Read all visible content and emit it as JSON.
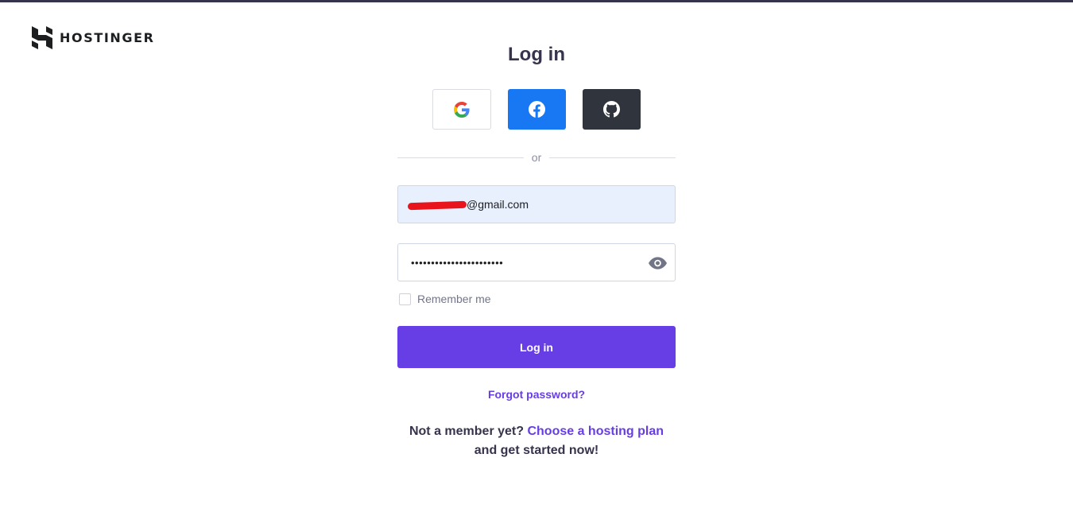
{
  "brand": {
    "name": "HOSTINGER",
    "logo_icon": "hostinger-h-logo-icon"
  },
  "page": {
    "title": "Log in"
  },
  "social": {
    "google_icon": "google-icon",
    "facebook_icon": "facebook-icon",
    "github_icon": "github-icon"
  },
  "divider": {
    "text": "or"
  },
  "form": {
    "email_value_suffix": "@gmail.com",
    "password_value": "•••••••••••••••••••••••",
    "remember_label": "Remember me",
    "submit_label": "Log in",
    "forgot_label": "Forgot password?"
  },
  "footer": {
    "prefix": "Not a member yet?",
    "link": "Choose a hosting plan",
    "suffix": "and get started now!"
  },
  "colors": {
    "accent": "#673de6",
    "facebook": "#1877f2",
    "github": "#2f343d",
    "text_dark": "#36344d"
  }
}
